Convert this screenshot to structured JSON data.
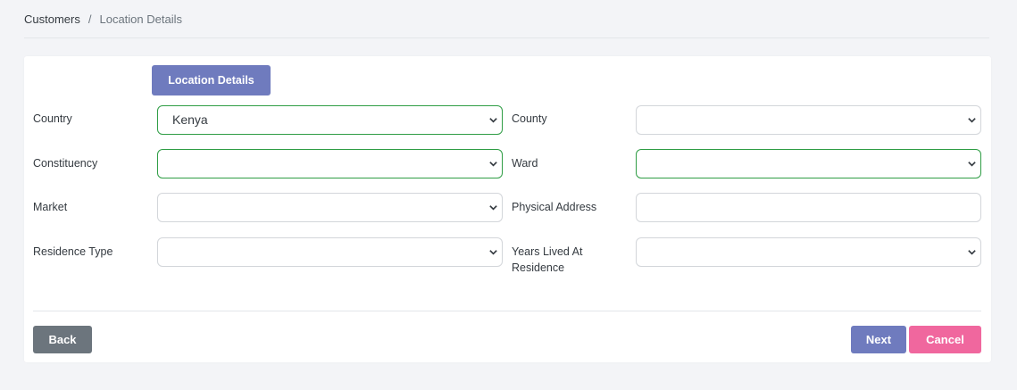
{
  "breadcrumb": {
    "root": "Customers",
    "separator": "/",
    "current": "Location Details"
  },
  "tab": {
    "label": "Location Details"
  },
  "fields": {
    "country": {
      "label": "Country",
      "value": "Kenya"
    },
    "county": {
      "label": "County",
      "value": ""
    },
    "constituency": {
      "label": "Constituency",
      "value": ""
    },
    "ward": {
      "label": "Ward",
      "value": ""
    },
    "market": {
      "label": "Market",
      "value": ""
    },
    "physical_address": {
      "label": "Physical Address",
      "value": ""
    },
    "residence_type": {
      "label": "Residence Type",
      "value": ""
    },
    "years_lived_line1": "Years Lived At",
    "years_lived_line2": "Residence",
    "years_lived": {
      "value": ""
    }
  },
  "buttons": {
    "back": "Back",
    "next": "Next",
    "cancel": "Cancel"
  },
  "colors": {
    "primary": "#6f7bbe",
    "secondary": "#6c757d",
    "danger": "#f0679e",
    "valid_border": "#2f9d45"
  }
}
